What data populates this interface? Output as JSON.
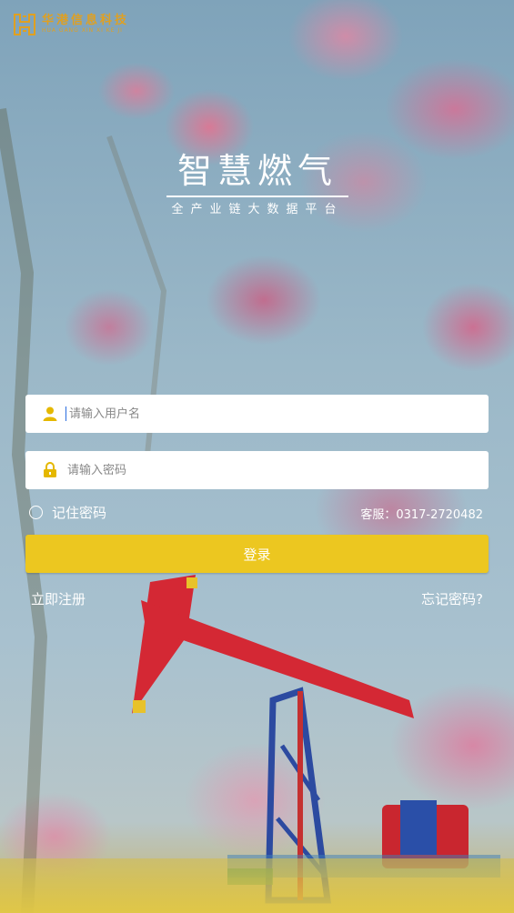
{
  "logo": {
    "name_cn": "华港信息科技",
    "name_en": "HUA GANG XIN XI KE JI"
  },
  "title": {
    "main": "智慧燃气",
    "subtitle": "全产业链大数据平台"
  },
  "form": {
    "username_placeholder": "请输入用户名",
    "password_placeholder": "请输入密码",
    "remember_label": "记住密码",
    "service_text": "客服：0317-2720482",
    "login_label": "登录",
    "register_label": "立即注册",
    "forgot_label": "忘记密码?"
  },
  "icons": {
    "user": "user-icon",
    "lock": "lock-icon"
  },
  "colors": {
    "accent": "#ecc720",
    "logo": "#e0a020",
    "icon": "#e5b800"
  }
}
